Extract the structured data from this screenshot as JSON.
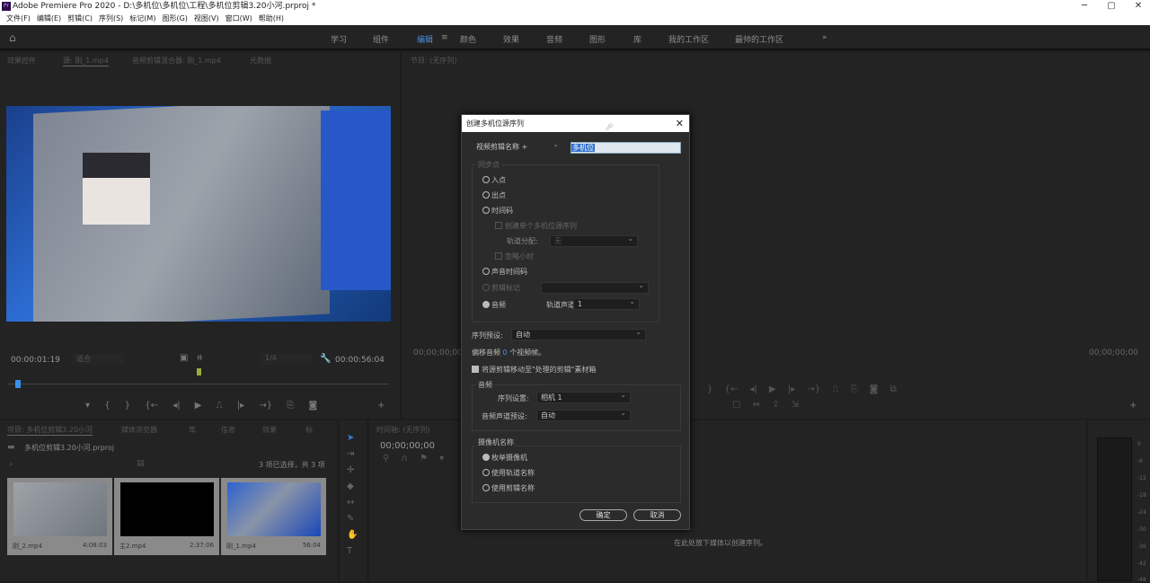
{
  "titlebar": {
    "logo": "Pr",
    "title": "Adobe Premiere Pro 2020 - D:\\多机位\\多机位\\工程\\多机位剪辑3.20小河.prproj *",
    "minimize": "─",
    "maximize": "▢",
    "close": "✕"
  },
  "menu": [
    "文件(F)",
    "编辑(E)",
    "剪辑(C)",
    "序列(S)",
    "标记(M)",
    "图形(G)",
    "视图(V)",
    "窗口(W)",
    "帮助(H)"
  ],
  "workspaces": {
    "items": [
      "学习",
      "组件",
      "编辑",
      "颜色",
      "效果",
      "音频",
      "图形",
      "库",
      "我的工作区",
      "最帅的工作区"
    ],
    "active": "编辑",
    "more": "»",
    "home_icon": "home-icon"
  },
  "source_panel": {
    "tabs": [
      "效果控件",
      "源: 刚_1.mp4",
      "音频剪辑混合器: 刚_1.mp4",
      "元数据"
    ],
    "timecode": "00:00:01:19",
    "fit": "适合",
    "quality": "1/4",
    "duration": "00:00:56:04"
  },
  "program_panel": {
    "tab": "节目: (无序列)",
    "timecode_left": "00;00;00;00",
    "timecode_right": "00;00;00;00"
  },
  "dialog": {
    "title": "创建多机位源序列",
    "name_mode": "视频剪辑名称 +",
    "name_value": "多机位",
    "sync_group": "同步点",
    "sync_options": [
      {
        "label": "入点",
        "selected": false,
        "enabled": true
      },
      {
        "label": "出点",
        "selected": false,
        "enabled": true
      },
      {
        "label": "时间码",
        "selected": false,
        "enabled": true
      }
    ],
    "create_single": "创建单个多机位源序列",
    "track_assign_label": "轨道分配:",
    "track_assign_value": "无",
    "ignore_hours": "忽略小时",
    "audio_timecode": "声音时间码",
    "clip_marker": "剪辑标记",
    "audio": "音频",
    "track_channel_label": "轨道声道",
    "track_channel_value": "1",
    "seq_preset_label": "序列预设:",
    "seq_preset_value": "自动",
    "offset_prefix": "偏移音频",
    "offset_value": "0",
    "offset_suffix": "个视频帧。",
    "move_clips": "将源剪辑移动至\"处理的剪辑\"素材箱",
    "move_clips_checked": true,
    "audio_group": "音频",
    "seq_settings_label": "序列设置:",
    "seq_settings_value": "相机 1",
    "channel_preset_label": "音频声道预设:",
    "channel_preset_value": "自动",
    "camera_group": "摄像机名称",
    "camera_options": [
      {
        "label": "枚举摄像机",
        "selected": true
      },
      {
        "label": "使用轨道名称",
        "selected": false
      },
      {
        "label": "使用剪辑名称",
        "selected": false
      }
    ],
    "ok": "确定",
    "cancel": "取消"
  },
  "project_panel": {
    "tabs": [
      "项目: 多机位剪辑3.20小河",
      "媒体浏览器",
      "库",
      "信息",
      "效果",
      "标"
    ],
    "file": "多机位剪辑3.20小河.prproj",
    "selection": "3 项已选择，共 3 项",
    "clips": [
      {
        "name": "刚_2.mp4",
        "duration": "4:08:03"
      },
      {
        "name": "主2.mp4",
        "duration": "2:37:06"
      },
      {
        "name": "刚_1.mp4",
        "duration": "56:04"
      }
    ]
  },
  "timeline": {
    "tab": "时间轴: (无序列)",
    "timecode": "00;00;00;00",
    "empty_hint": "在此处放下媒体以创建序列。"
  },
  "meters": {
    "labels": [
      "0",
      "-6",
      "-12",
      "-18",
      "-24",
      "-30",
      "-36",
      "-42",
      "-48"
    ]
  }
}
